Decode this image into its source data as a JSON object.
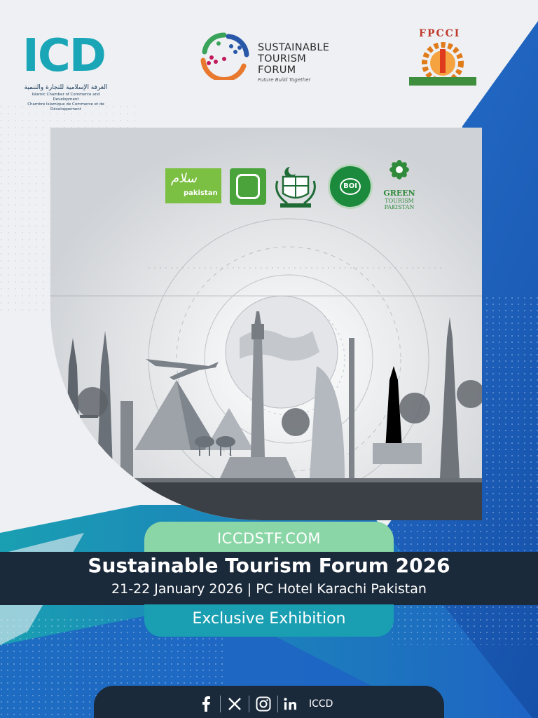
{
  "header_logos": {
    "icd": {
      "letters": "ICD",
      "arabic": "الغرفة الإسلامية للتجارة والتنمية",
      "english": "Islamic Chamber of Commerce and Development",
      "french": "Chambre Islamique de Commerce et de Développement"
    },
    "stf": {
      "line1": "SUSTAINABLE",
      "line2": "TOURISM",
      "line3": "FORUM",
      "tagline": "Future Build Together"
    },
    "fpcci": {
      "name": "FPCCI"
    }
  },
  "partners": {
    "pakistan_tourism_label": "pakistan",
    "boi_label": "BOI",
    "green_tourism": [
      "GREEN",
      "TOURISM",
      "PAKISTAN"
    ]
  },
  "event": {
    "website": "ICCDSTF.COM",
    "title": "Sustainable Tourism Forum 2026",
    "date_venue": "21-22 January 2026 | PC Hotel Karachi Pakistan",
    "subtitle": "Exclusive Exhibition"
  },
  "social": {
    "handle": "ICCD",
    "icons": [
      "facebook-icon",
      "x-icon",
      "instagram-icon",
      "linkedin-icon"
    ]
  },
  "colors": {
    "navy": "#1b2a3b",
    "teal": "#1a9fb2",
    "mint": "#8ad6a6",
    "blue": "#1e63c4"
  }
}
